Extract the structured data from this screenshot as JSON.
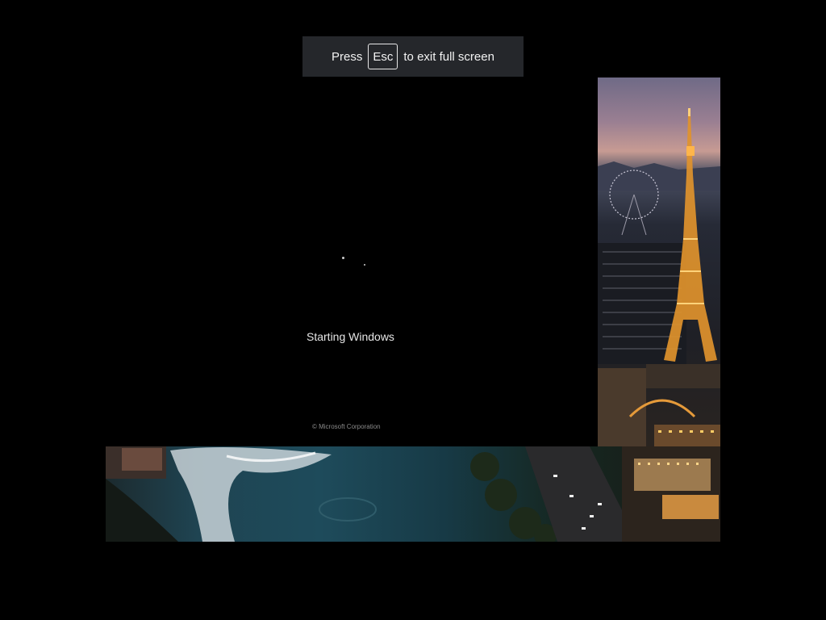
{
  "fullscreen_hint": {
    "prefix": "Press",
    "key": "Esc",
    "suffix": "to exit full screen"
  },
  "boot": {
    "status": "Starting Windows",
    "copyright": "© Microsoft Corporation"
  },
  "colors": {
    "hint_background": "#25272b",
    "boot_background": "#000000"
  },
  "icons": {
    "spinner": "loading-spinner-icon"
  }
}
